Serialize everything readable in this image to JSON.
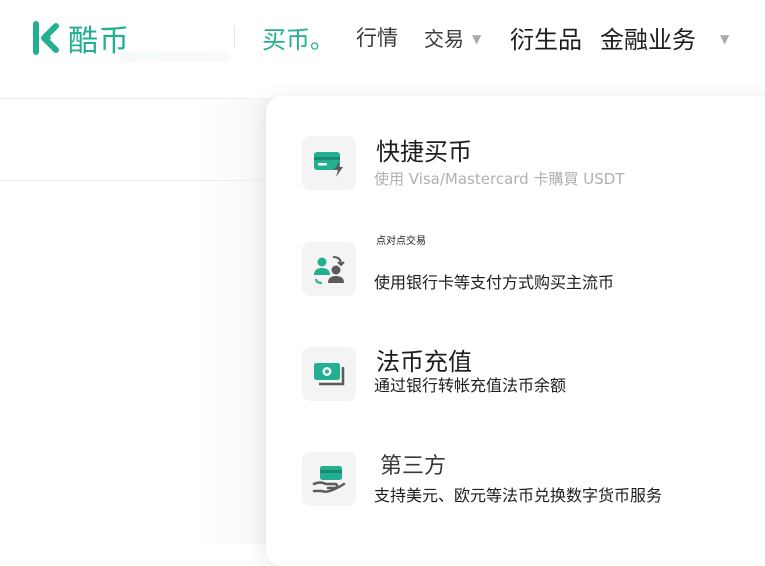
{
  "brand": {
    "name": "酷币",
    "color": "#23af91"
  },
  "nav": {
    "buy": "买币。",
    "market": "行情",
    "trade": "交易",
    "derivatives": "衍生品",
    "finance": "金融业务"
  },
  "menu": {
    "items": [
      {
        "title": "快捷买币",
        "desc": "使用 Visa/Mastercard 卡購買 USDT",
        "icon": "card-flash-icon"
      },
      {
        "title": "点对点交易",
        "desc": "使用银行卡等支付方式购买主流币",
        "icon": "p2p-users-icon"
      },
      {
        "title": "法币充值",
        "desc": "通过银行转帐充值法币余额",
        "icon": "cash-deposit-icon"
      },
      {
        "title": "第三方",
        "desc": "支持美元、欧元等法币兑换数字货币服务",
        "icon": "card-hand-icon"
      }
    ]
  }
}
